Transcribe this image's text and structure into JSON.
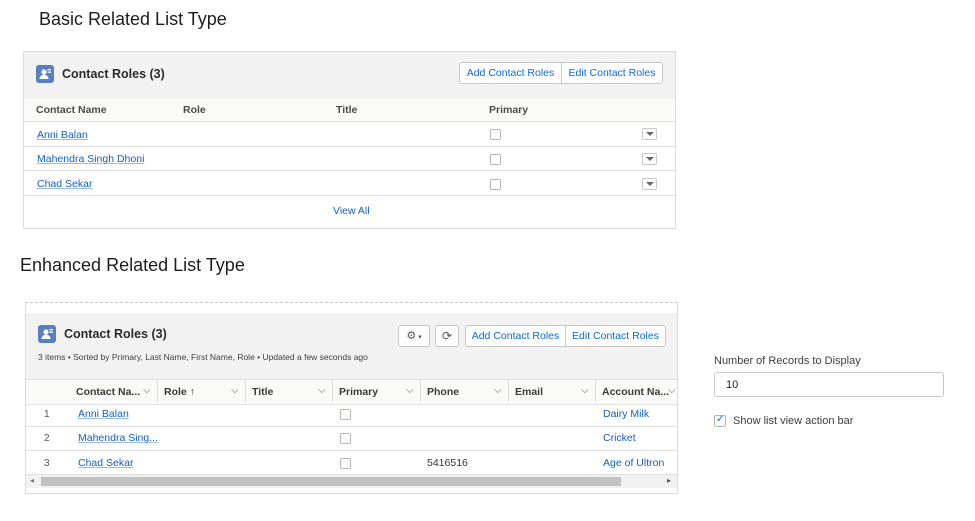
{
  "basic": {
    "heading": "Basic Related List Type",
    "card_title": "Contact Roles (3)",
    "buttons": {
      "add": "Add Contact Roles",
      "edit": "Edit Contact Roles"
    },
    "columns": [
      "Contact Name",
      "Role",
      "Title",
      "Primary"
    ],
    "rows": [
      {
        "name": "Anni Balan"
      },
      {
        "name": "Mahendra Singh Dhoni"
      },
      {
        "name": "Chad Sekar"
      }
    ],
    "footer_link": "View All"
  },
  "enhanced": {
    "heading": "Enhanced Related List Type",
    "card_title": "Contact Roles (3)",
    "subtitle": "3 items • Sorted by Primary, Last Name, First Name, Role • Updated a few seconds ago",
    "buttons": {
      "add": "Add Contact Roles",
      "edit": "Edit Contact Roles"
    },
    "columns": [
      "Contact Na...",
      "Role ↑",
      "Title",
      "Primary",
      "Phone",
      "Email",
      "Account Na..."
    ],
    "rows": [
      {
        "num": "1",
        "name": "Anni Balan",
        "phone": "",
        "account": "Dairy Milk"
      },
      {
        "num": "2",
        "name": "Mahendra Sing...",
        "phone": "",
        "account": "Cricket"
      },
      {
        "num": "3",
        "name": "Chad Sekar",
        "phone": "5416516",
        "account": "Age of Ultron"
      }
    ]
  },
  "settings": {
    "records_label": "Number of Records to Display",
    "records_value": "10",
    "show_action_bar_label": "Show list view action bar",
    "show_action_bar_checked": true
  },
  "colors": {
    "link": "#1060c0",
    "icon": "#5a7ec2",
    "header_bg": "#f3f2f2"
  },
  "icons": [
    "contact-roles-icon",
    "gear-icon",
    "refresh-icon",
    "chevron-down-icon",
    "checkbox-icon"
  ]
}
